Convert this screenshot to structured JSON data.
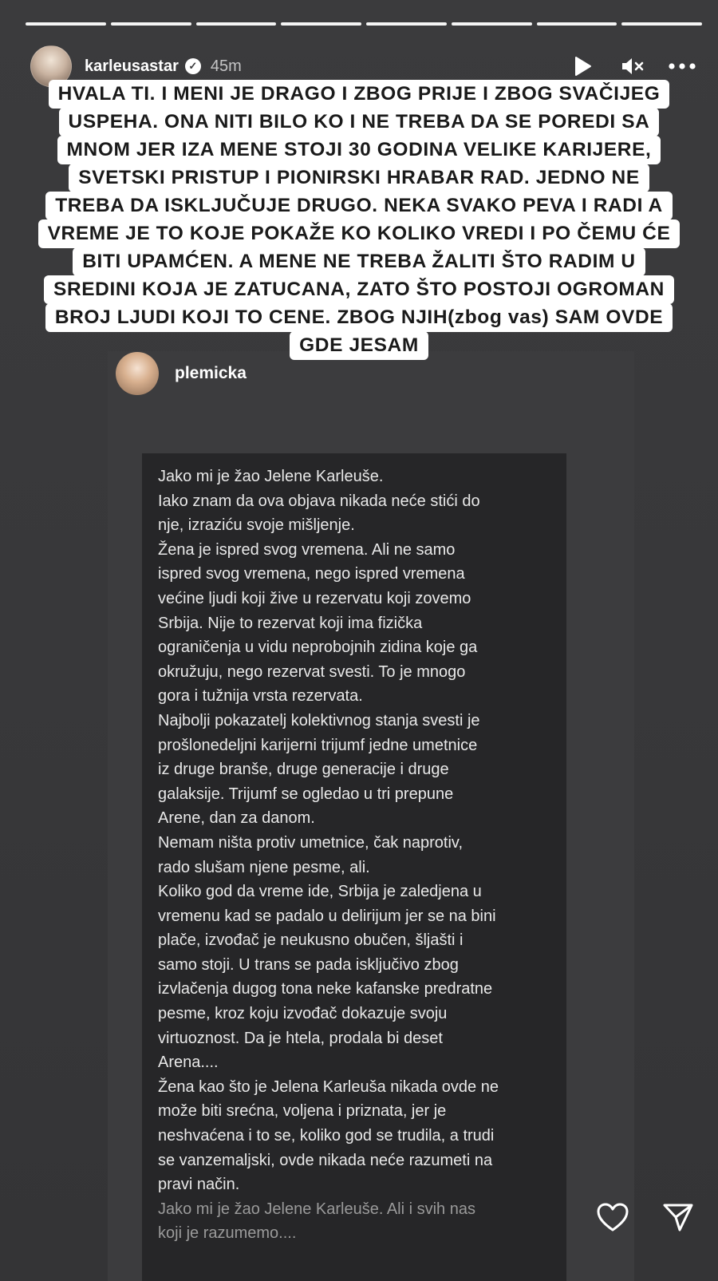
{
  "story": {
    "progress_segments": 8,
    "username": "karleusastar",
    "time_ago": "45m",
    "caption_lines": [
      "HVALA TI. I MENI JE  DRAGO I ZBOG PRIJE I ZBOG SVAČIJEG",
      "USPEHA. ONA NITI BILO KO I NE TREBA DA SE POREDI SA",
      "MNOM JER IZA MENE STOJI 30 GODINA VELIKE KARIJERE,",
      "SVETSKI PRISTUP I PIONIRSKI HRABAR RAD. JEDNO NE",
      "TREBA DA ISKLJUČUJE DRUGO. NEKA SVAKO PEVA I RADI A",
      "VREME JE TO KOJE POKAŽE KO KOLIKO VREDI I PO ČEMU ĆE",
      "BITI UPAMĆEN. A MENE NE TREBA ŽALITI ŠTO RADIM U",
      "SREDINI KOJA JE ZATUCANA, ZATO ŠTO POSTOJI OGROMAN",
      "BROJ LJUDI KOJI TO CENE. ZBOG NJIH(zbog vas) SAM OVDE",
      "GDE JESAM"
    ]
  },
  "embed": {
    "username": "plemicka",
    "note_lines": [
      "Jako mi je žao Jelene Karleuše.",
      "Iako znam da ova objava nikada neće stići do",
      "nje, izraziću svoje mišljenje.",
      "Žena je ispred svog vremena. Ali ne samo",
      "ispred svog vremena, nego ispred vremena",
      "većine ljudi koji žive u rezervatu koji zovemo",
      "Srbija. Nije to rezervat koji ima fizička",
      "ograničenja u vidu neprobojnih zidina koje ga",
      "okružuju, nego rezervat svesti. To je mnogo",
      "gora i tužnija vrsta rezervata.",
      "Najbolji pokazatelj kolektivnog stanja svesti je",
      "prošlonedeljni karijerni trijumf jedne umetnice",
      "iz druge branše, druge generacije i druge",
      "galaksije. Trijumf se ogledao u tri prepune",
      "Arene, dan za danom.",
      "Nemam ništa protiv umetnice, čak naprotiv,",
      "rado slušam njene pesme, ali.",
      "Koliko god da vreme ide, Srbija je zaledjena u",
      "vremenu kad se padalo u delirijum jer se na bini",
      "plače, izvođač je neukusno obučen, šljašti i",
      "samo stoji. U trans se pada isključivo zbog",
      "izvlačenja dugog tona neke kafanske predratne",
      "pesme, kroz koju izvođač dokazuje svoju",
      "virtuoznost. Da je htela, prodala bi deset",
      "Arena....",
      "Žena kao što je Jelena Karleuša nikada ovde ne",
      "može biti srećna, voljena i priznata, jer je",
      "neshvaćena i to se, koliko god se trudila, a trudi",
      "se vanzemaljski, ovde nikada neće razumeti na",
      "pravi način.",
      "Jako mi je žao Jelene Karleuše. Ali i svih nas",
      "koji je razumemo...."
    ]
  },
  "icons": {
    "play": "play-icon",
    "mute": "mute-icon",
    "more": "more-icon",
    "like": "heart-icon",
    "share": "send-icon"
  }
}
